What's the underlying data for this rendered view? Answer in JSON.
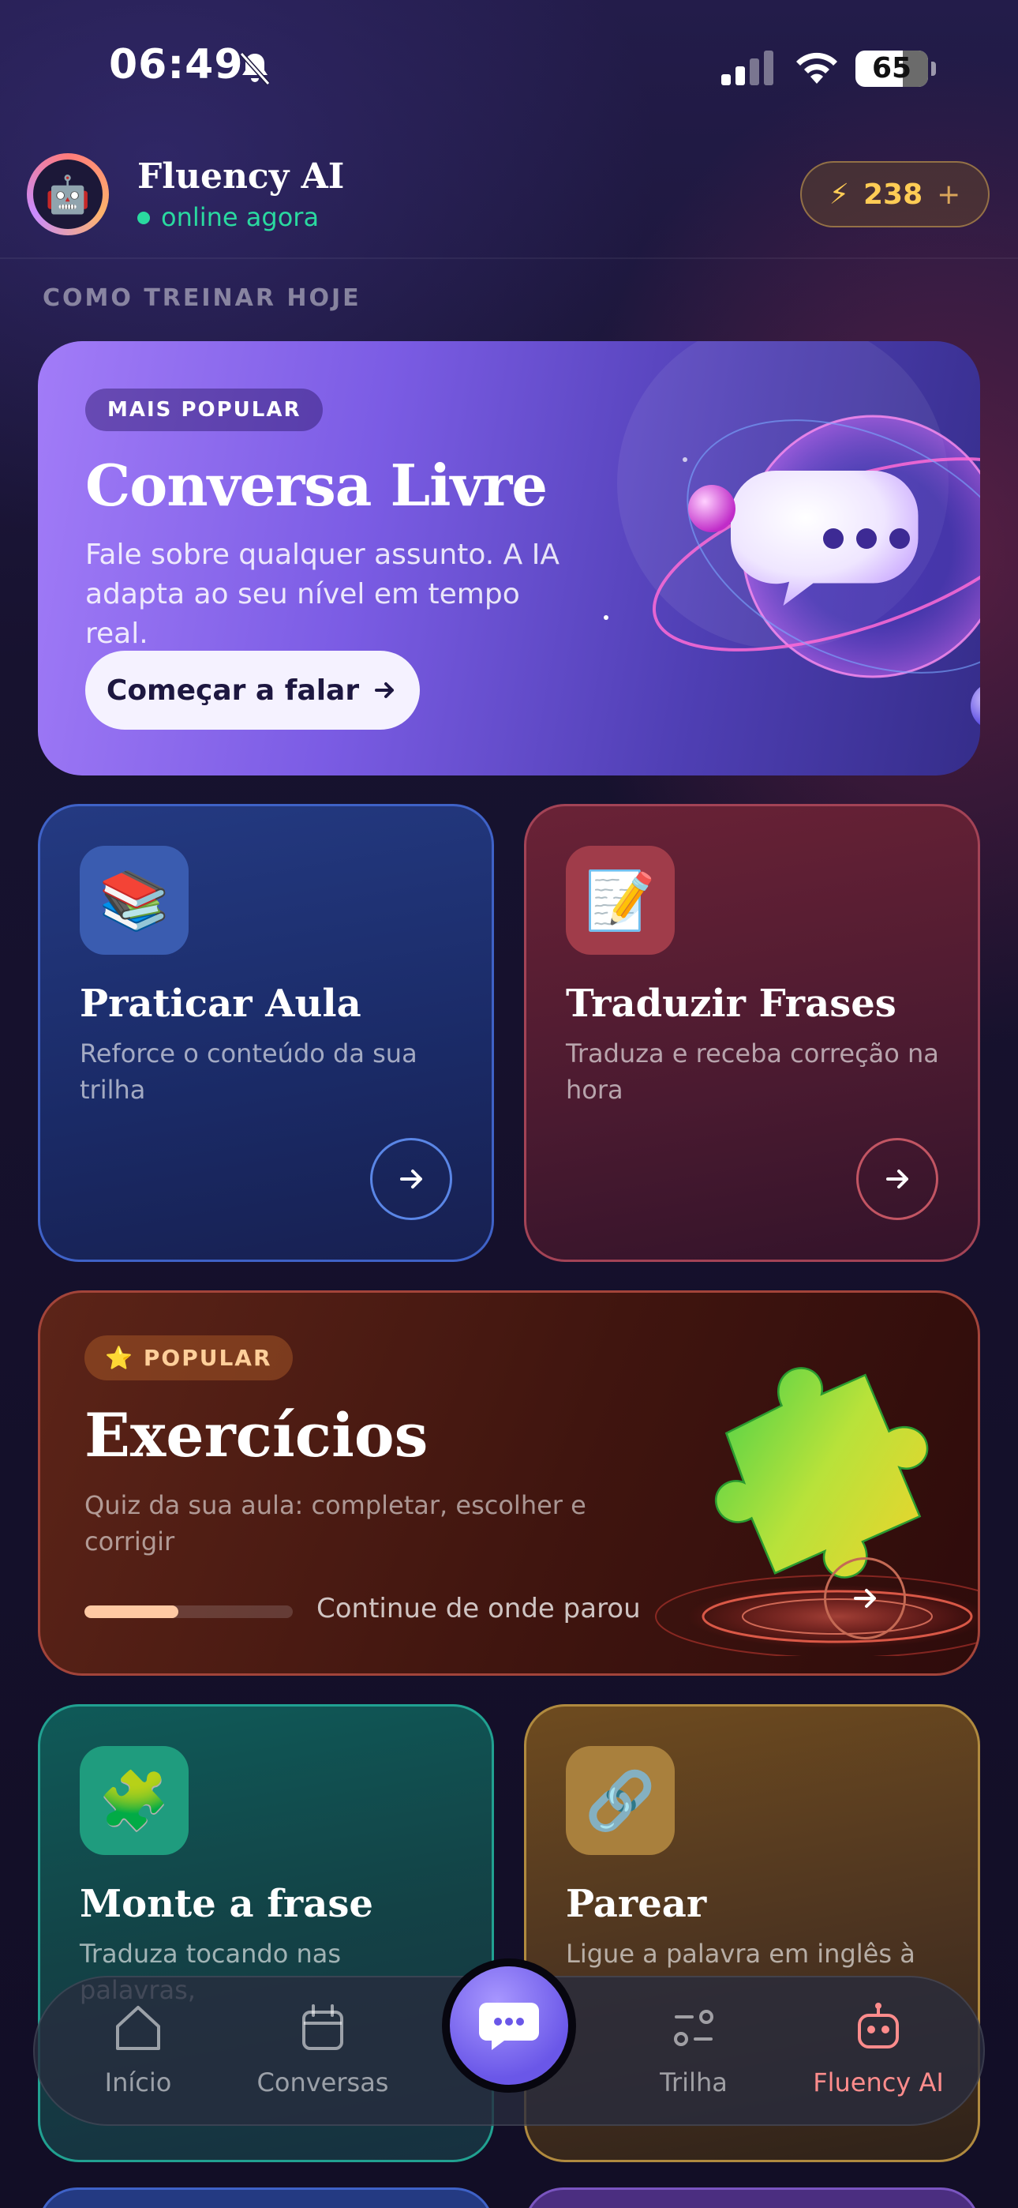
{
  "status_bar": {
    "time": "06:49",
    "battery": "65"
  },
  "header": {
    "app_name": "Fluency AI",
    "status": "online agora",
    "points": "238",
    "points_plus": "+",
    "avatar_icon": "robot-emoji"
  },
  "section_label": "COMO TREINAR HOJE",
  "hero": {
    "badge": "MAIS POPULAR",
    "title": "Conversa Livre",
    "description": "Fale sobre qualquer assunto. A IA adapta ao seu nível em tempo real.",
    "button": "Começar a falar"
  },
  "cards": {
    "aula": {
      "title": "Praticar Aula",
      "description": "Reforce o conteúdo da sua trilha",
      "icon": "books-emoji"
    },
    "traduzir": {
      "title": "Traduzir Frases",
      "description": "Traduza e receba correção na hora",
      "icon": "memo-emoji"
    },
    "monte": {
      "title": "Monte a frase",
      "description": "Traduza tocando nas palavras,",
      "icon": "puzzle-emoji"
    },
    "parear": {
      "title": "Parear",
      "description": "Ligue a palavra em inglês à",
      "icon": "link-emoji"
    }
  },
  "exercicios": {
    "badge": "POPULAR",
    "title": "Exercícios",
    "description": "Quiz da sua aula: completar, escolher e corrigir",
    "progress_fraction": 0.45,
    "continue": "Continue de onde parou"
  },
  "nav": {
    "items": [
      {
        "label": "Início",
        "icon": "home-icon"
      },
      {
        "label": "Conversas",
        "icon": "calendar-icon"
      },
      {
        "label": "Trilha",
        "icon": "path-icon"
      },
      {
        "label": "Fluency AI",
        "icon": "robot-icon"
      }
    ],
    "active": "Fluency AI",
    "center_icon": "chat-bubble-icon"
  },
  "colors": {
    "accent_green": "#2ad9a0",
    "points_gold": "#ffcc55",
    "active_nav": "#ff8c8c"
  }
}
